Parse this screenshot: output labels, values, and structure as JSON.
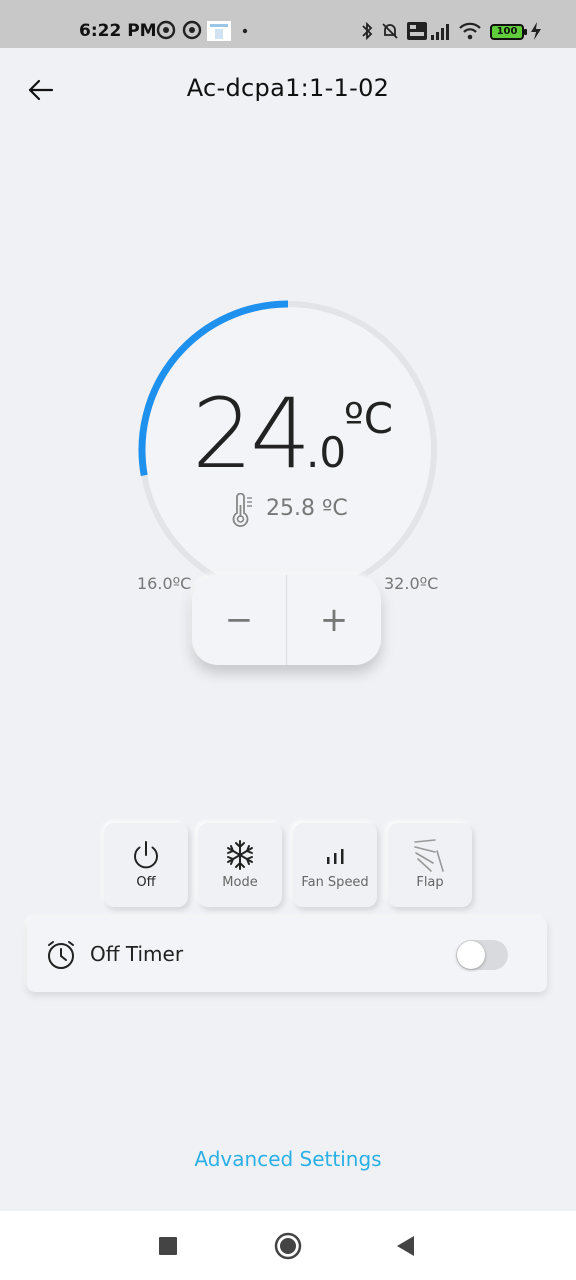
{
  "status_bar": {
    "time": "6:22 PM",
    "battery": "100"
  },
  "header": {
    "title": "Ac-dcpa1:1-1-02"
  },
  "dial": {
    "setpoint_int": "24",
    "setpoint_dec": ".0",
    "unit": "ºC",
    "room_temp": "25.8 ºC",
    "min_label": "16.0ºC",
    "max_label": "32.0ºC",
    "min_value": 16.0,
    "max_value": 32.0,
    "setpoint_value": 24.0,
    "accent_color": "#1e90ee"
  },
  "stepper": {
    "minus": "−",
    "plus": "+"
  },
  "controls": [
    {
      "label": "Off",
      "icon": "power-icon"
    },
    {
      "label": "Mode",
      "icon": "snowflake-icon"
    },
    {
      "label": "Fan Speed",
      "icon": "fan-speed-icon"
    },
    {
      "label": "Flap",
      "icon": "flap-icon"
    }
  ],
  "timer": {
    "label": "Off Timer",
    "enabled": false
  },
  "advanced_settings": "Advanced Settings"
}
